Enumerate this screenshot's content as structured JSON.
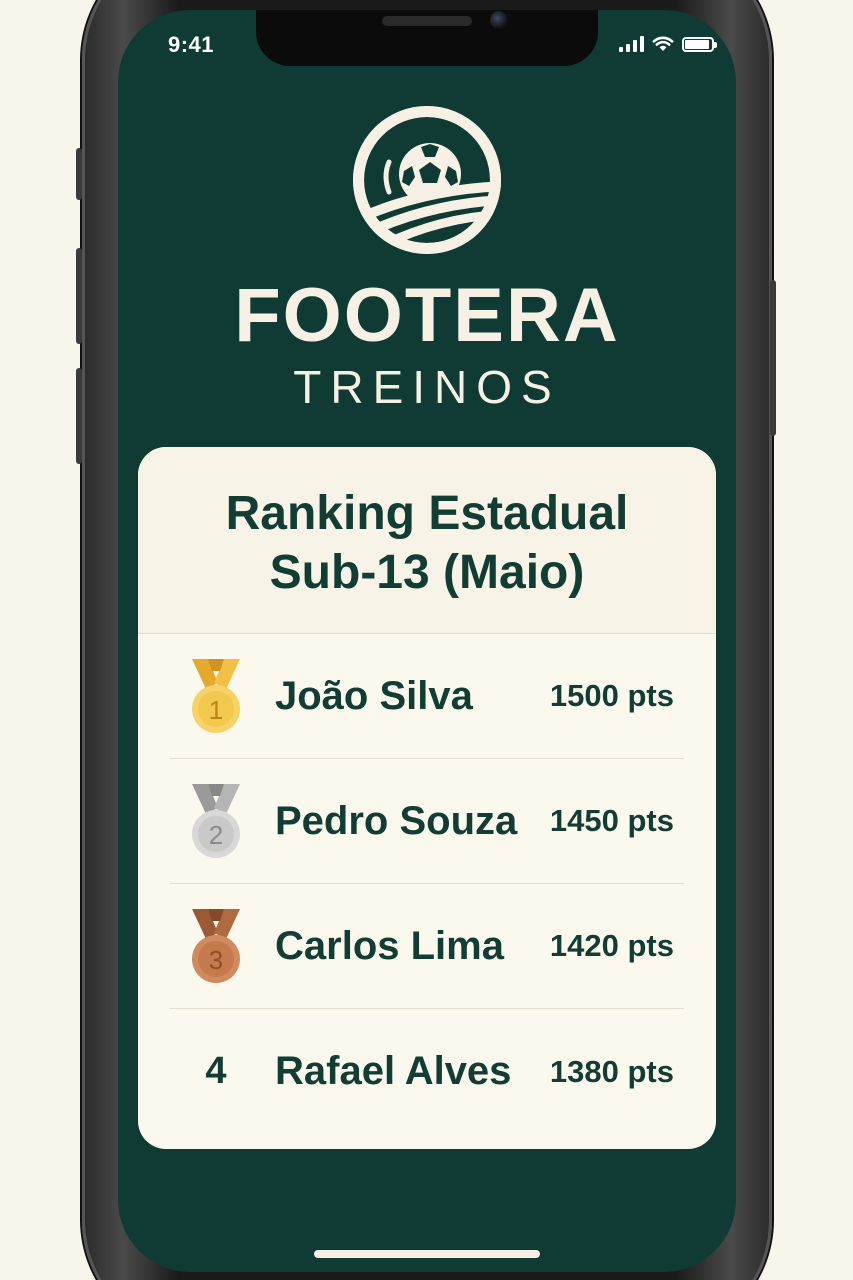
{
  "status_bar": {
    "time": "9:41",
    "icons": [
      "cellular-signal-icon",
      "wifi-icon",
      "battery-icon"
    ]
  },
  "brand": {
    "logo_icon": "soccer-ball-logo-icon",
    "name": "FOOTERA",
    "subtitle": "TREINOS"
  },
  "ranking": {
    "title_line1": "Ranking Estadual",
    "title_line2": "Sub-13 (Maio)",
    "entries": [
      {
        "rank": "1",
        "medal": "gold-medal-icon",
        "name": "João Silva",
        "points": "1500 pts"
      },
      {
        "rank": "2",
        "medal": "silver-medal-icon",
        "name": "Pedro Souza",
        "points": "1450 pts"
      },
      {
        "rank": "3",
        "medal": "bronze-medal-icon",
        "name": "Carlos Lima",
        "points": "1420 pts"
      },
      {
        "rank": "4",
        "medal": null,
        "name": "Rafael Alves",
        "points": "1380 pts"
      }
    ]
  },
  "colors": {
    "screen_background": "#0f3b34",
    "card_background": "#fbf8ee",
    "text_dark_green": "#123d35",
    "gold": "#f0c24b",
    "silver": "#c9c9c9",
    "bronze": "#c47a4c"
  }
}
